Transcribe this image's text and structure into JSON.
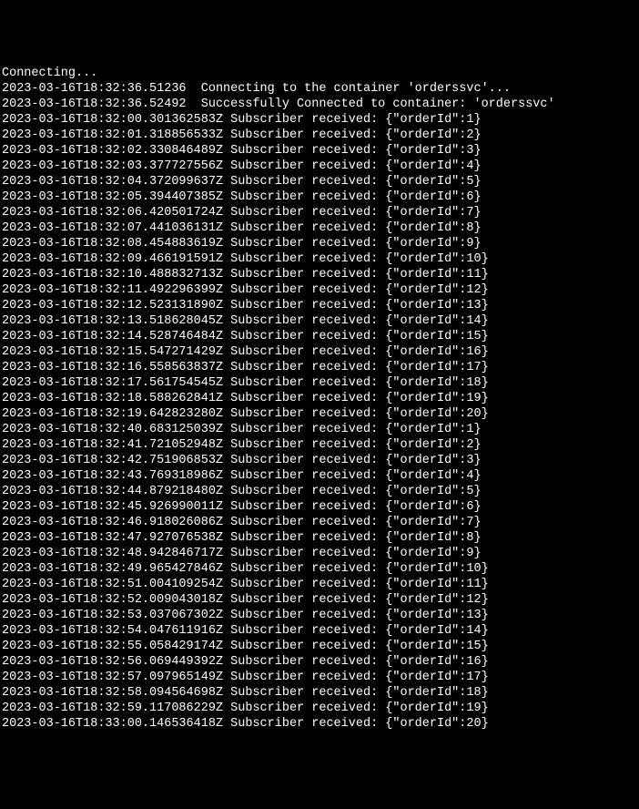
{
  "header": {
    "connecting": "Connecting...",
    "ts1": "2023-03-16T18:32:36.51236",
    "msg1": "Connecting to the container 'orderssvc'...",
    "ts2": "2023-03-16T18:32:36.52492",
    "msg2": "Successfully Connected to container: 'orderssvc'"
  },
  "label": "Subscriber received:",
  "logs": [
    {
      "ts": "2023-03-16T18:32:00.301362583Z",
      "payload": "{\"orderId\":1}"
    },
    {
      "ts": "2023-03-16T18:32:01.318856533Z",
      "payload": "{\"orderId\":2}"
    },
    {
      "ts": "2023-03-16T18:32:02.330846489Z",
      "payload": "{\"orderId\":3}"
    },
    {
      "ts": "2023-03-16T18:32:03.377727556Z",
      "payload": "{\"orderId\":4}"
    },
    {
      "ts": "2023-03-16T18:32:04.372099637Z",
      "payload": "{\"orderId\":5}"
    },
    {
      "ts": "2023-03-16T18:32:05.394407385Z",
      "payload": "{\"orderId\":6}"
    },
    {
      "ts": "2023-03-16T18:32:06.420501724Z",
      "payload": "{\"orderId\":7}"
    },
    {
      "ts": "2023-03-16T18:32:07.441036131Z",
      "payload": "{\"orderId\":8}"
    },
    {
      "ts": "2023-03-16T18:32:08.454883619Z",
      "payload": "{\"orderId\":9}"
    },
    {
      "ts": "2023-03-16T18:32:09.466191591Z",
      "payload": "{\"orderId\":10}"
    },
    {
      "ts": "2023-03-16T18:32:10.488832713Z",
      "payload": "{\"orderId\":11}"
    },
    {
      "ts": "2023-03-16T18:32:11.492296399Z",
      "payload": "{\"orderId\":12}"
    },
    {
      "ts": "2023-03-16T18:32:12.523131890Z",
      "payload": "{\"orderId\":13}"
    },
    {
      "ts": "2023-03-16T18:32:13.518628045Z",
      "payload": "{\"orderId\":14}"
    },
    {
      "ts": "2023-03-16T18:32:14.528746484Z",
      "payload": "{\"orderId\":15}"
    },
    {
      "ts": "2023-03-16T18:32:15.547271429Z",
      "payload": "{\"orderId\":16}"
    },
    {
      "ts": "2023-03-16T18:32:16.558563837Z",
      "payload": "{\"orderId\":17}"
    },
    {
      "ts": "2023-03-16T18:32:17.561754545Z",
      "payload": "{\"orderId\":18}"
    },
    {
      "ts": "2023-03-16T18:32:18.588262841Z",
      "payload": "{\"orderId\":19}"
    },
    {
      "ts": "2023-03-16T18:32:19.642823280Z",
      "payload": "{\"orderId\":20}"
    },
    {
      "ts": "2023-03-16T18:32:40.683125039Z",
      "payload": "{\"orderId\":1}"
    },
    {
      "ts": "2023-03-16T18:32:41.721052948Z",
      "payload": "{\"orderId\":2}"
    },
    {
      "ts": "2023-03-16T18:32:42.751906853Z",
      "payload": "{\"orderId\":3}"
    },
    {
      "ts": "2023-03-16T18:32:43.769318986Z",
      "payload": "{\"orderId\":4}"
    },
    {
      "ts": "2023-03-16T18:32:44.879218480Z",
      "payload": "{\"orderId\":5}"
    },
    {
      "ts": "2023-03-16T18:32:45.926990011Z",
      "payload": "{\"orderId\":6}"
    },
    {
      "ts": "2023-03-16T18:32:46.918026086Z",
      "payload": "{\"orderId\":7}"
    },
    {
      "ts": "2023-03-16T18:32:47.927076538Z",
      "payload": "{\"orderId\":8}"
    },
    {
      "ts": "2023-03-16T18:32:48.942846717Z",
      "payload": "{\"orderId\":9}"
    },
    {
      "ts": "2023-03-16T18:32:49.965427846Z",
      "payload": "{\"orderId\":10}"
    },
    {
      "ts": "2023-03-16T18:32:51.004109254Z",
      "payload": "{\"orderId\":11}"
    },
    {
      "ts": "2023-03-16T18:32:52.009043018Z",
      "payload": "{\"orderId\":12}"
    },
    {
      "ts": "2023-03-16T18:32:53.037067302Z",
      "payload": "{\"orderId\":13}"
    },
    {
      "ts": "2023-03-16T18:32:54.047611916Z",
      "payload": "{\"orderId\":14}"
    },
    {
      "ts": "2023-03-16T18:32:55.058429174Z",
      "payload": "{\"orderId\":15}"
    },
    {
      "ts": "2023-03-16T18:32:56.069449392Z",
      "payload": "{\"orderId\":16}"
    },
    {
      "ts": "2023-03-16T18:32:57.097965149Z",
      "payload": "{\"orderId\":17}"
    },
    {
      "ts": "2023-03-16T18:32:58.094564698Z",
      "payload": "{\"orderId\":18}"
    },
    {
      "ts": "2023-03-16T18:32:59.117086229Z",
      "payload": "{\"orderId\":19}"
    },
    {
      "ts": "2023-03-16T18:33:00.146536418Z",
      "payload": "{\"orderId\":20}"
    }
  ]
}
